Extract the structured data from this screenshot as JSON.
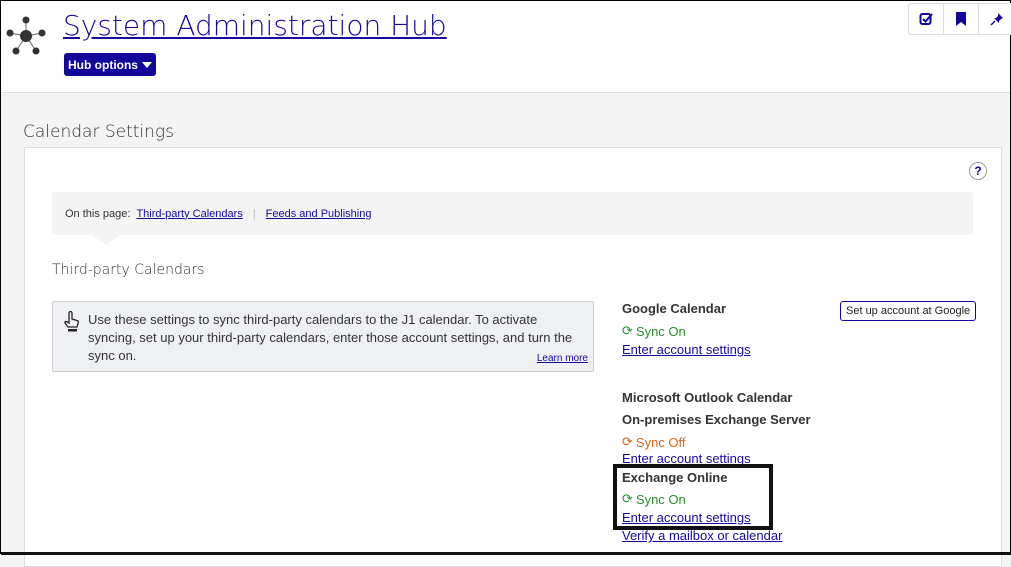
{
  "header": {
    "title": "System Administration Hub",
    "hub_options": "Hub options"
  },
  "toolbar": {
    "icons": [
      "checklist-icon",
      "bookmark-icon",
      "pin-icon"
    ]
  },
  "page": {
    "title": "Calendar Settings",
    "help": "?"
  },
  "nav": {
    "label": "On this page:",
    "links": [
      "Third-party Calendars",
      "Feeds and Publishing"
    ],
    "separator": "|"
  },
  "section": {
    "title": "Third-party Calendars"
  },
  "info": {
    "text": "Use these settings to sync third-party calendars to the J1 calendar. To activate syncing, set up your third-party calendars, enter those account settings, and turn the sync on.",
    "learn_more": "Learn more"
  },
  "google": {
    "title": "Google Calendar",
    "status": "Sync On",
    "link": "Enter account settings",
    "setup_button": "Set up account at Google"
  },
  "outlook": {
    "title": "Microsoft Outlook Calendar",
    "onprem": {
      "title": "On-premises Exchange Server",
      "status": "Sync Off",
      "link": "Enter account settings"
    },
    "online": {
      "title": "Exchange Online",
      "status": "Sync On",
      "link": "Enter account settings",
      "verify": "Verify a mailbox or calendar"
    }
  },
  "colors": {
    "brand": "#12069b",
    "sync_on": "#2e8b2e",
    "sync_off": "#d2691e"
  }
}
